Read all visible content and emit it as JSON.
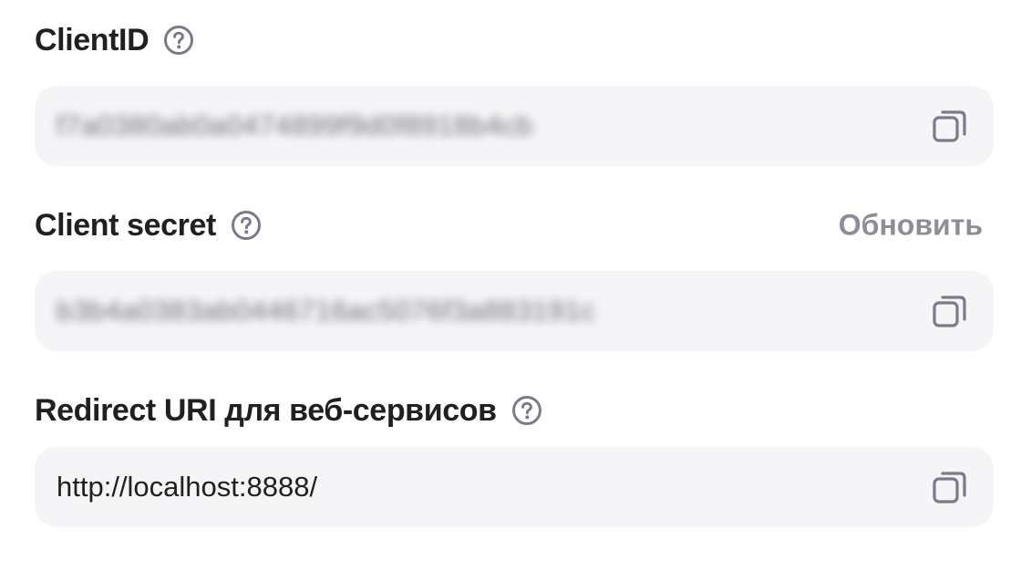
{
  "client_id": {
    "label": "ClientID",
    "value": "f7a0380ab0a0474899f9d0f8918b4cb",
    "help_icon": "question-circle-icon",
    "copy_icon": "copy-icon"
  },
  "client_secret": {
    "label": "Client secret",
    "action_label": "Обновить",
    "value": "b3b4a0383ab0446716ac5076f3a883191c",
    "help_icon": "question-circle-icon",
    "copy_icon": "copy-icon"
  },
  "redirect_uri": {
    "label": "Redirect URI для веб-сервисов",
    "value": "http://localhost:8888/",
    "help_icon": "question-circle-icon",
    "copy_icon": "copy-icon"
  },
  "colors": {
    "text": "#21201f",
    "muted": "#8e8c97",
    "field_bg": "#f5f5f7",
    "icon": "#7c7a8a"
  }
}
